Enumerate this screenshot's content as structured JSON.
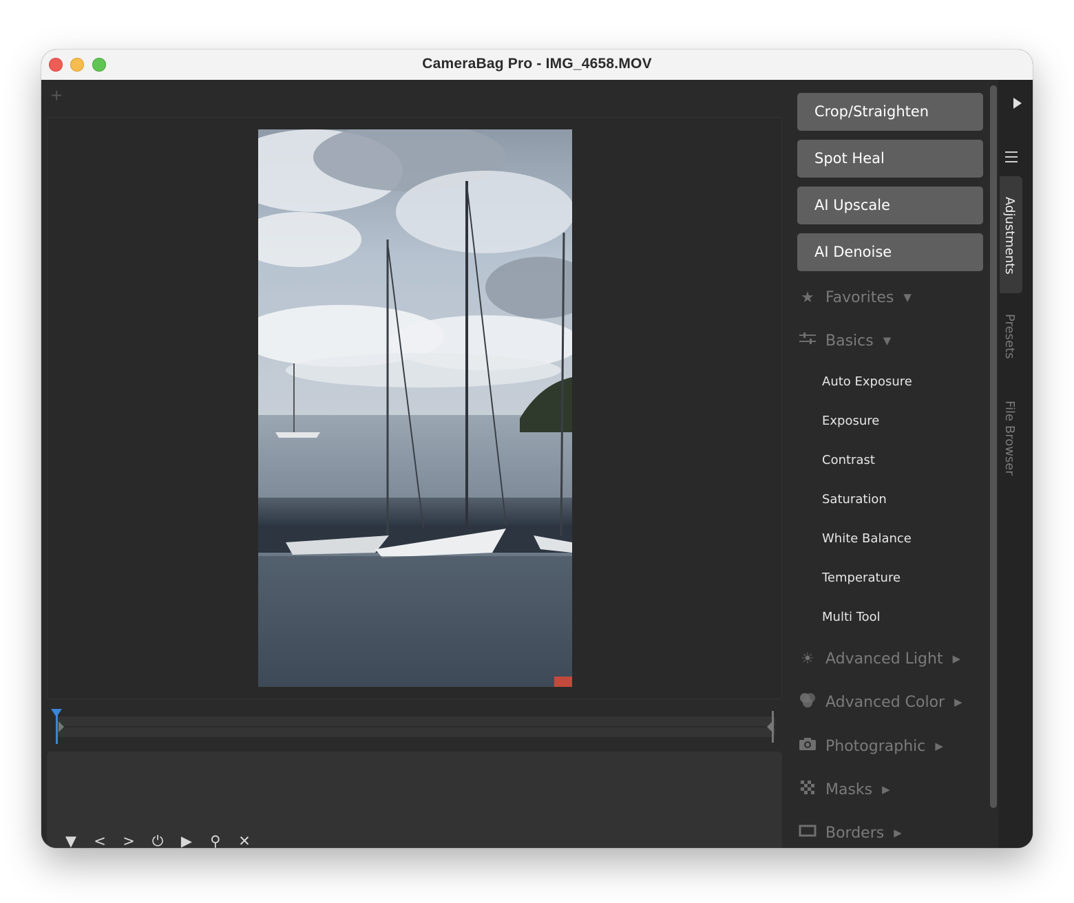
{
  "window": {
    "title": "CameraBag Pro - IMG_4658.MOV"
  },
  "toolbar": {
    "add_icon": "plus-icon"
  },
  "tools": [
    {
      "label": "Crop/Straighten"
    },
    {
      "label": "Spot Heal"
    },
    {
      "label": "AI Upscale"
    },
    {
      "label": "AI Denoise"
    }
  ],
  "sections": {
    "favorites": {
      "label": "Favorites",
      "icon": "star-icon",
      "expanded": true
    },
    "basics": {
      "label": "Basics",
      "icon": "sliders-icon",
      "expanded": true,
      "items": [
        "Auto Exposure",
        "Exposure",
        "Contrast",
        "Saturation",
        "White Balance",
        "Temperature",
        "Multi Tool"
      ]
    },
    "advanced_light": {
      "label": "Advanced Light",
      "icon": "sun-icon",
      "expanded": false
    },
    "advanced_color": {
      "label": "Advanced Color",
      "icon": "color-circles-icon",
      "expanded": false
    },
    "photographic": {
      "label": "Photographic",
      "icon": "camera-icon",
      "expanded": false
    },
    "masks": {
      "label": "Masks",
      "icon": "checkerboard-icon",
      "expanded": false
    },
    "borders": {
      "label": "Borders",
      "icon": "border-frame-icon",
      "expanded": false
    }
  },
  "sidebar": {
    "tabs": [
      {
        "label": "Adjustments",
        "active": true
      },
      {
        "label": "Presets",
        "active": false
      },
      {
        "label": "File Browser",
        "active": false
      }
    ]
  },
  "playback_controls": [
    "dropdown-triangle-icon",
    "previous-icon",
    "next-icon",
    "power-icon",
    "play-icon",
    "search-icon",
    "close-icon"
  ],
  "colors": {
    "accent": "#3a86d8",
    "button_bg": "#5f5f5f",
    "panel_bg": "#2a2a2a"
  }
}
